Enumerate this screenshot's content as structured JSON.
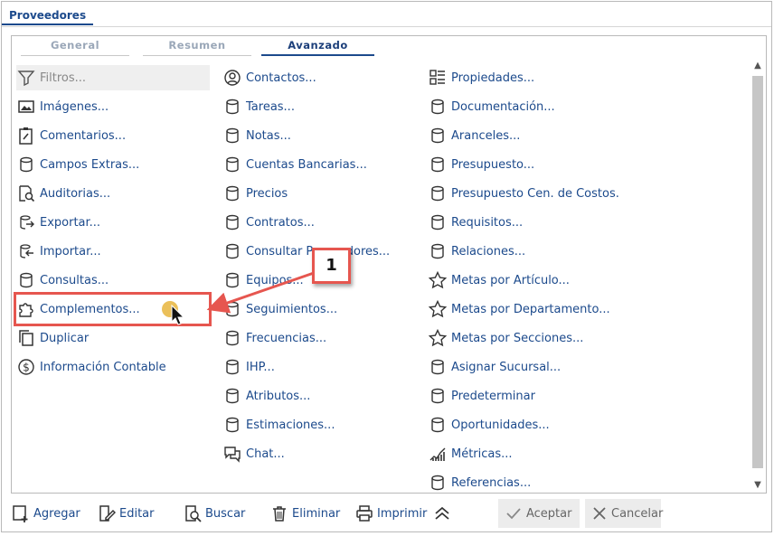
{
  "window": {
    "tab_title": "Proveedores"
  },
  "subtabs": [
    {
      "label": "General"
    },
    {
      "label": "Resumen"
    },
    {
      "label": "Avanzado"
    }
  ],
  "columns": {
    "col1": [
      {
        "label": "Filtros...",
        "icon": "filter-icon"
      },
      {
        "label": "Imágenes...",
        "icon": "image-icon"
      },
      {
        "label": "Comentarios...",
        "icon": "clipboard-edit-icon"
      },
      {
        "label": "Campos Extras...",
        "icon": "database-icon"
      },
      {
        "label": "Auditorias...",
        "icon": "document-search-icon"
      },
      {
        "label": "Exportar...",
        "icon": "export-icon"
      },
      {
        "label": "Importar...",
        "icon": "import-icon"
      },
      {
        "label": "Consultas...",
        "icon": "database-icon"
      },
      {
        "label": "Complementos...",
        "icon": "puzzle-icon"
      },
      {
        "label": "Duplicar",
        "icon": "copy-icon"
      },
      {
        "label": "Información Contable",
        "icon": "dollar-icon"
      }
    ],
    "col2": [
      {
        "label": "Contactos...",
        "icon": "person-icon"
      },
      {
        "label": "Tareas...",
        "icon": "database-icon"
      },
      {
        "label": "Notas...",
        "icon": "database-icon"
      },
      {
        "label": "Cuentas Bancarias...",
        "icon": "database-icon"
      },
      {
        "label": "Precios",
        "icon": "database-icon"
      },
      {
        "label": "Contratos...",
        "icon": "database-icon"
      },
      {
        "label": "Consultar Proveedores...",
        "icon": "database-icon"
      },
      {
        "label": "Equipos...",
        "icon": "database-icon"
      },
      {
        "label": "Seguimientos...",
        "icon": "database-icon"
      },
      {
        "label": "Frecuencias...",
        "icon": "database-icon"
      },
      {
        "label": "IHP...",
        "icon": "database-icon"
      },
      {
        "label": "Atributos...",
        "icon": "database-icon"
      },
      {
        "label": "Estimaciones...",
        "icon": "database-icon"
      },
      {
        "label": "Chat...",
        "icon": "chat-icon"
      }
    ],
    "col3": [
      {
        "label": "Propiedades...",
        "icon": "properties-icon"
      },
      {
        "label": "Documentación...",
        "icon": "database-icon"
      },
      {
        "label": "Aranceles...",
        "icon": "database-icon"
      },
      {
        "label": "Presupuesto...",
        "icon": "database-icon"
      },
      {
        "label": "Presupuesto Cen. de Costos.",
        "icon": "database-icon"
      },
      {
        "label": "Requisitos...",
        "icon": "database-icon"
      },
      {
        "label": "Relaciones...",
        "icon": "database-icon"
      },
      {
        "label": "Metas por Artículo...",
        "icon": "star-icon"
      },
      {
        "label": "Metas por Departamento...",
        "icon": "star-icon"
      },
      {
        "label": "Metas por Secciones...",
        "icon": "star-icon"
      },
      {
        "label": "Asignar Sucursal...",
        "icon": "database-icon"
      },
      {
        "label": "Predeterminar",
        "icon": "database-icon"
      },
      {
        "label": "Oportunidades...",
        "icon": "database-icon"
      },
      {
        "label": "Métricas...",
        "icon": "chart-icon"
      },
      {
        "label": "Referencias...",
        "icon": "database-icon"
      }
    ]
  },
  "annotation": {
    "callout_number": "1",
    "color": "#e6564f"
  },
  "footer": {
    "add": "Agregar",
    "edit": "Editar",
    "search": "Buscar",
    "delete": "Eliminar",
    "print": "Imprimir",
    "accept": "Aceptar",
    "cancel": "Cancelar"
  },
  "colors": {
    "accent": "#1c4a8c",
    "highlight": "#e6564f"
  }
}
